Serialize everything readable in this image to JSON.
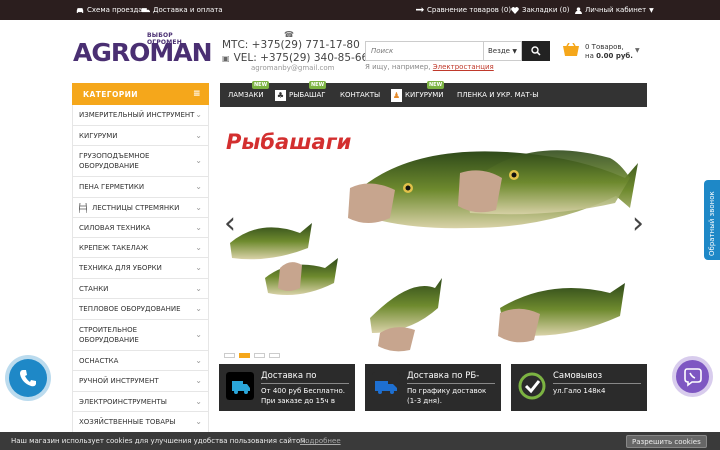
{
  "topbar": {
    "left": [
      {
        "label": "Схема проезда",
        "icon": "car-icon"
      },
      {
        "label": "Доставка и оплата",
        "icon": "truck-icon"
      }
    ],
    "right": [
      {
        "label": "Сравнение товаров (0)",
        "icon": "compare-icon"
      },
      {
        "label": "Закладки (0)",
        "icon": "heart-icon"
      },
      {
        "label": "Личный кабинет",
        "icon": "user-icon"
      }
    ]
  },
  "logo": {
    "word": "AGROMAN",
    "tagline": "ВЫБОР ОГРОМЕН"
  },
  "contacts": {
    "phone1": "МТС: +375(29) 771-17-80",
    "phone2": "VEL: +375(29) 340-85-66",
    "email": "agromanby@gmail.com"
  },
  "search": {
    "placeholder": "Поиск",
    "scope": "Везде",
    "hint_prefix": "Я ищу, например,",
    "hint_link": "Электростанция"
  },
  "cart": {
    "count": "0 Товаров,",
    "total_prefix": "на",
    "total": "0.00 руб."
  },
  "sidebar": {
    "header": "КАТЕГОРИИ",
    "items": [
      {
        "label": "ИЗМЕРИТЕЛЬНЫЙ ИНСТРУМЕНТ"
      },
      {
        "label": "КИГУРУМИ"
      },
      {
        "label": "ГРУЗОПОДЪЕМНОЕ ОБОРУДОВАНИЕ"
      },
      {
        "label": "ПЕНА ГЕРМЕТИКИ"
      },
      {
        "label": "ЛЕСТНИЦЫ СТРЕМЯНКИ"
      },
      {
        "label": "СИЛОВАЯ ТЕХНИКА"
      },
      {
        "label": "КРЕПЕЖ ТАКЕЛАЖ"
      },
      {
        "label": "ТЕХНИКА ДЛЯ УБОРКИ"
      },
      {
        "label": "СТАНКИ"
      },
      {
        "label": "ТЕПЛОВОЕ ОБОРУДОВАНИЕ"
      },
      {
        "label": "СТРОИТЕЛЬНОЕ ОБОРУДОВАНИЕ"
      },
      {
        "label": "ОСНАСТКА"
      },
      {
        "label": "РУЧНОЙ ИНСТРУМЕНТ"
      },
      {
        "label": "ЭЛЕКТРОИНСТРУМЕНТЫ"
      },
      {
        "label": "ХОЗЯЙСТВЕННЫЕ ТОВАРЫ"
      }
    ]
  },
  "nav": {
    "items": [
      {
        "label": "ЛАМЗАКИ",
        "badge": "NEW"
      },
      {
        "label": "РЫБАШАГ",
        "badge": "NEW"
      },
      {
        "label": "КОНТАКТЫ"
      },
      {
        "label": "КИГУРУМИ",
        "badge": "NEW"
      },
      {
        "label": "ПЛЕНКА И УКР. МАТ-Ы"
      }
    ]
  },
  "slider": {
    "title": "Рыбашаги",
    "active_slide": 2,
    "slide_count": 4
  },
  "promos": [
    {
      "title": "Доставка по",
      "desc1": "От 400 руб Бесплатно.",
      "desc2": "При заказе до 15ч в",
      "icon": "delivery-icon"
    },
    {
      "title": "Доставка по РБ-",
      "desc1": "По графику доставок",
      "desc2": "(1-3 дня).",
      "icon": "truck-icon"
    },
    {
      "title": "Самовывоз",
      "desc1": "ул.Гало 148к4",
      "desc2": "",
      "icon": "check-icon"
    }
  ],
  "callback": {
    "label": "Обратный звонок"
  },
  "cookie": {
    "text": "Наш магазин использует cookies для улучшения удобства пользования сайтом.",
    "more": "Подробнее",
    "accept": "Разрешить cookies"
  },
  "colors": {
    "accent": "#f5a71b",
    "topbar": "#2b1e1e",
    "brand": "#4a2f72",
    "nav": "#333333",
    "new_badge": "#7cb342",
    "title_red": "#d32f2f"
  }
}
